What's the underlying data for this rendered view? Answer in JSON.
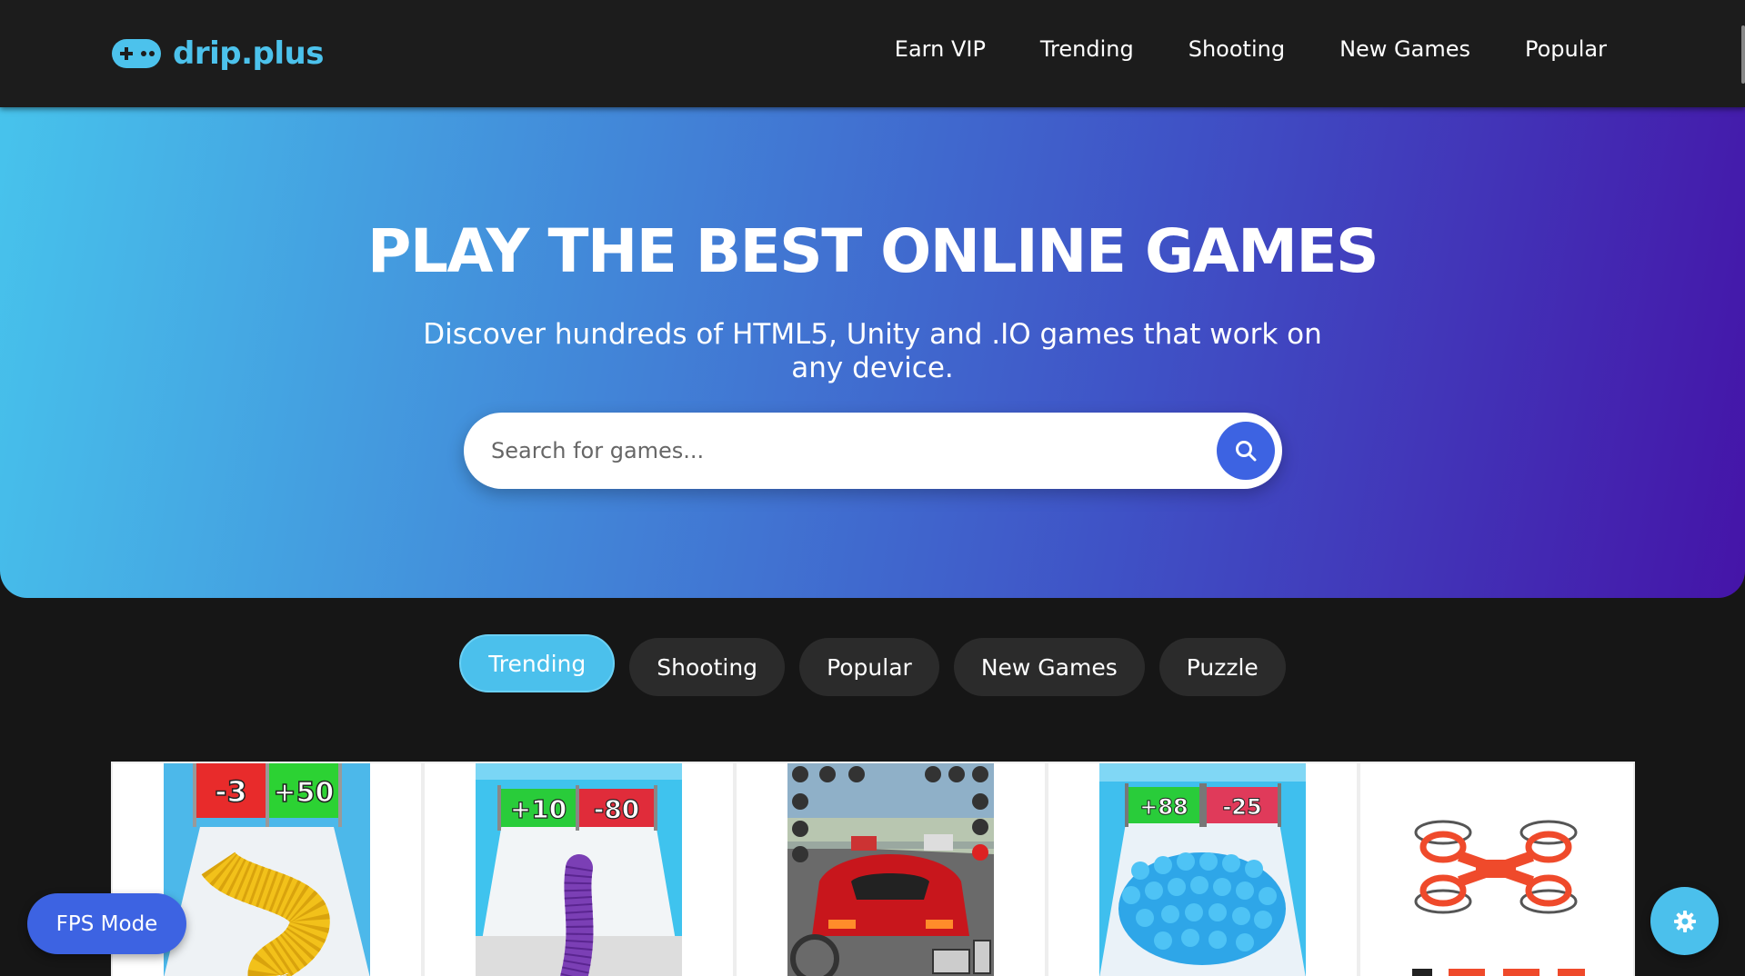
{
  "header": {
    "logo_text": "drip.plus",
    "nav": [
      "Earn VIP",
      "Trending",
      "Shooting",
      "New Games",
      "Popular"
    ]
  },
  "hero": {
    "title": "PLAY THE BEST ONLINE GAMES",
    "subtitle": "Discover hundreds of HTML5, Unity and .IO games that work on any device.",
    "search_placeholder": "Search for games..."
  },
  "categories": [
    {
      "label": "Trending",
      "active": true
    },
    {
      "label": "Shooting",
      "active": false
    },
    {
      "label": "Popular",
      "active": false
    },
    {
      "label": "New Games",
      "active": false
    },
    {
      "label": "Puzzle",
      "active": false
    }
  ],
  "games": {
    "tiles": [
      {
        "gate_left": "-3",
        "gate_right": "+50",
        "icon": "domino-runner-thumbnail"
      },
      {
        "gate_left": "+10",
        "gate_right": "-80",
        "icon": "snake-runner-thumbnail"
      },
      {
        "icon": "racing-car-thumbnail"
      },
      {
        "gate_left": "+88",
        "gate_right": "-25",
        "icon": "crowd-runner-thumbnail"
      },
      {
        "icon": "drone-thumbnail"
      }
    ]
  },
  "floating": {
    "fps_label": "FPS Mode",
    "settings_icon": "gear-icon"
  },
  "colors": {
    "accent": "#4bc0ec",
    "primary_blue": "#3d63e2",
    "header_bg": "#1c1c1c",
    "page_bg": "#161616"
  }
}
